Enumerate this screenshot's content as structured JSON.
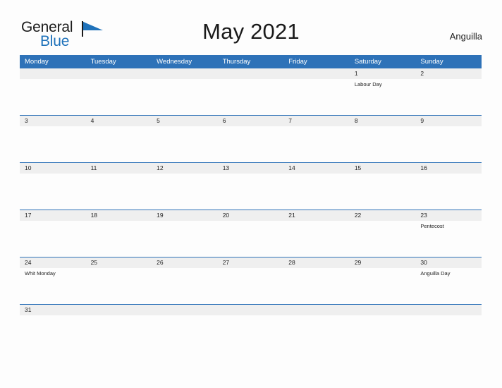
{
  "logo": {
    "text_top": "General",
    "text_bottom": "Blue",
    "icon": "flag-triangle-icon",
    "color_blue": "#1f72ba",
    "color_dark": "#1b1b1b"
  },
  "header": {
    "title": "May 2021",
    "country": "Anguilla"
  },
  "theme": {
    "header_blue": "#2e72b8",
    "date_band_gray": "#efefef",
    "page_background": "#fdfdfd",
    "text_dark": "#222222",
    "weekday_text": "#ffffff"
  },
  "calendar": {
    "weekdays": [
      "Monday",
      "Tuesday",
      "Wednesday",
      "Thursday",
      "Friday",
      "Saturday",
      "Sunday"
    ],
    "weeks": [
      [
        {
          "date": "",
          "events": []
        },
        {
          "date": "",
          "events": []
        },
        {
          "date": "",
          "events": []
        },
        {
          "date": "",
          "events": []
        },
        {
          "date": "",
          "events": []
        },
        {
          "date": "1",
          "events": [
            "Labour Day"
          ]
        },
        {
          "date": "2",
          "events": []
        }
      ],
      [
        {
          "date": "3",
          "events": []
        },
        {
          "date": "4",
          "events": []
        },
        {
          "date": "5",
          "events": []
        },
        {
          "date": "6",
          "events": []
        },
        {
          "date": "7",
          "events": []
        },
        {
          "date": "8",
          "events": []
        },
        {
          "date": "9",
          "events": []
        }
      ],
      [
        {
          "date": "10",
          "events": []
        },
        {
          "date": "11",
          "events": []
        },
        {
          "date": "12",
          "events": []
        },
        {
          "date": "13",
          "events": []
        },
        {
          "date": "14",
          "events": []
        },
        {
          "date": "15",
          "events": []
        },
        {
          "date": "16",
          "events": []
        }
      ],
      [
        {
          "date": "17",
          "events": []
        },
        {
          "date": "18",
          "events": []
        },
        {
          "date": "19",
          "events": []
        },
        {
          "date": "20",
          "events": []
        },
        {
          "date": "21",
          "events": []
        },
        {
          "date": "22",
          "events": []
        },
        {
          "date": "23",
          "events": [
            "Pentecost"
          ]
        }
      ],
      [
        {
          "date": "24",
          "events": [
            "Whit Monday"
          ]
        },
        {
          "date": "25",
          "events": []
        },
        {
          "date": "26",
          "events": []
        },
        {
          "date": "27",
          "events": []
        },
        {
          "date": "28",
          "events": []
        },
        {
          "date": "29",
          "events": []
        },
        {
          "date": "30",
          "events": [
            "Anguilla Day"
          ]
        }
      ],
      [
        {
          "date": "31",
          "events": []
        },
        {
          "date": "",
          "events": []
        },
        {
          "date": "",
          "events": []
        },
        {
          "date": "",
          "events": []
        },
        {
          "date": "",
          "events": []
        },
        {
          "date": "",
          "events": []
        },
        {
          "date": "",
          "events": []
        }
      ]
    ]
  }
}
